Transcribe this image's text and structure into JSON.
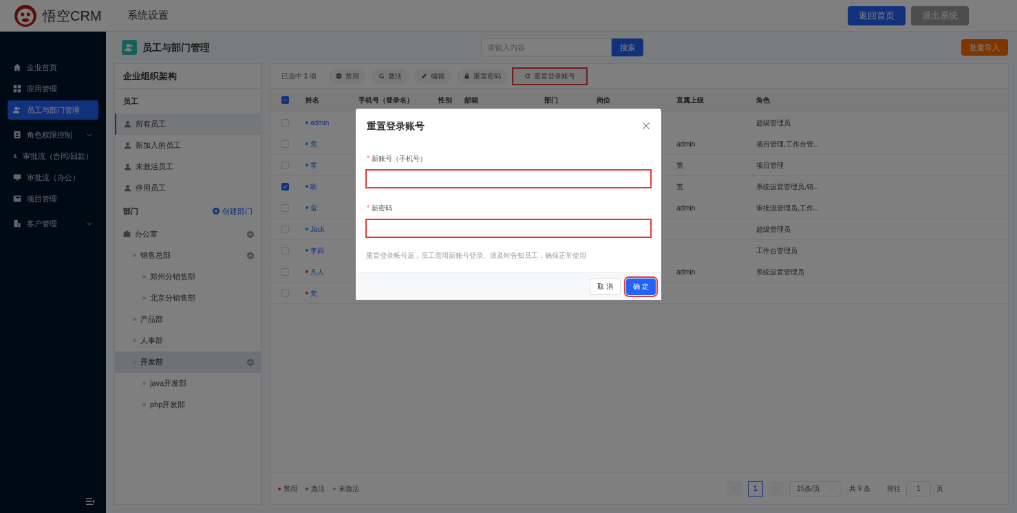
{
  "header": {
    "logo_text": "悟空CRM",
    "title": "系统设置",
    "buttons": [
      {
        "label": "返回首页",
        "kind": "primary"
      },
      {
        "label": "退出系统",
        "kind": "muted"
      }
    ]
  },
  "sidebar": {
    "items": [
      {
        "label": "企业首页",
        "selected": false
      },
      {
        "label": "应用管理",
        "selected": false
      },
      {
        "label": "员工与部门管理",
        "selected": true
      },
      {
        "label": "角色权限控制",
        "selected": false,
        "has_submenu": true
      },
      {
        "label": "审批流（合同/回款）",
        "selected": false
      },
      {
        "label": "审批流（办公）",
        "selected": false
      },
      {
        "label": "项目管理",
        "selected": false
      },
      {
        "label": "客户管理",
        "selected": false,
        "has_submenu": true
      }
    ]
  },
  "page": {
    "title": "员工与部门管理",
    "search": {
      "placeholder": "请输入内容",
      "button": "搜索"
    },
    "import_button": "批量导入"
  },
  "org_panel": {
    "title": "企业组织架构",
    "employees_heading": "员工",
    "employee_filters": [
      {
        "label": "所有员工",
        "selected": true
      },
      {
        "label": "新加入的员工",
        "selected": false
      },
      {
        "label": "未激活员工",
        "selected": false
      },
      {
        "label": "停用员工",
        "selected": false
      }
    ],
    "departments_heading": "部门",
    "create_link": "创建部门",
    "departments": [
      {
        "label": "办公室",
        "expanded": true,
        "selected": false,
        "children": [
          {
            "label": "销售总部",
            "expanded": true,
            "selected": false,
            "children": [
              {
                "label": "郑州分销售部",
                "selected": false
              },
              {
                "label": "北京分销售部",
                "selected": false
              }
            ]
          },
          {
            "label": "产品部",
            "selected": false
          },
          {
            "label": "人事部",
            "selected": false
          },
          {
            "label": "开发部",
            "expanded": true,
            "selected": true,
            "children": [
              {
                "label": "java开发部",
                "selected": false
              },
              {
                "label": "php开发部",
                "selected": false
              }
            ]
          }
        ]
      }
    ]
  },
  "table": {
    "selection_text": "已选中 **1** 项",
    "toolbar": [
      {
        "label": "禁用",
        "highlighted": false
      },
      {
        "label": "激活",
        "highlighted": false
      },
      {
        "label": "编辑",
        "highlighted": false
      },
      {
        "label": "重置密码",
        "highlighted": false
      },
      {
        "label": "重置登录账号",
        "highlighted": true
      }
    ],
    "header_checkbox": {
      "indeterminate": true
    },
    "columns": [
      "姓名",
      "手机号（登录名）",
      "性别",
      "邮箱",
      "部门",
      "岗位",
      "直属上级",
      "角色"
    ],
    "rows": [
      {
        "name": "admin",
        "color": "#0a534d",
        "checked": false,
        "superior": "",
        "role": "超级管理员"
      },
      {
        "name": "荒",
        "color": "#0a534d",
        "checked": false,
        "superior": "admin",
        "role": "项目管理,工作台管..."
      },
      {
        "name": "零",
        "color": "#0a534d",
        "checked": false,
        "superior": "荒",
        "role": "项目管理"
      },
      {
        "name": "睚",
        "color": "#0a534d",
        "checked": true,
        "superior": "荒",
        "role": "系统设置管理员,销..."
      },
      {
        "name": "萤",
        "color": "#0a534d",
        "checked": false,
        "superior": "admin",
        "role": "审批流管理员,工作..."
      },
      {
        "name": "Jack",
        "color": "#0a534d",
        "checked": false,
        "superior": "",
        "role": "超级管理员"
      },
      {
        "name": "李四",
        "color": "#0a534d",
        "checked": false,
        "superior": "",
        "role": "工作台管理员"
      },
      {
        "name": "凡人",
        "color": "#721c1b",
        "checked": false,
        "superior": "admin",
        "role": "系统设置管理员"
      },
      {
        "name": "梵",
        "color": "#721c1b",
        "checked": false,
        "superior": "",
        "role": ""
      }
    ],
    "legend": [
      {
        "label": "禁用",
        "color": "#721c1b"
      },
      {
        "label": "激活",
        "color": "#0a534d"
      },
      {
        "label": "未激活",
        "color": "#555555"
      }
    ],
    "pagination": {
      "pages": [
        {
          "label": "1",
          "selected": true
        }
      ],
      "page_size": "15条/页",
      "total": "共 9 条",
      "goto_label": "前往",
      "goto_value": "1",
      "goto_suffix": "页"
    }
  },
  "dialog": {
    "title": "重置登录账号",
    "fields": [
      {
        "label": "新账号（手机号）",
        "required_mark": "*",
        "highlighted": true
      },
      {
        "label": "新密码",
        "required_mark": "*",
        "highlighted": true
      }
    ],
    "hint": "重置登录帐号后，员工需用新账号登录。请及时告知员工，确保正常使用",
    "buttons": [
      {
        "label": "取 消",
        "kind": "default",
        "highlighted": false
      },
      {
        "label": "确 定",
        "kind": "primary",
        "highlighted": true
      }
    ]
  }
}
